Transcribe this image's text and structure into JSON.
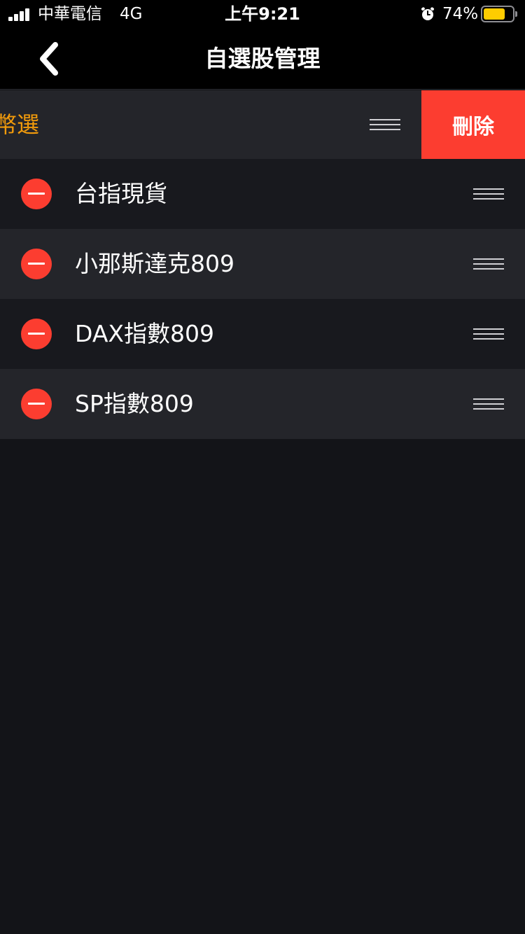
{
  "status_bar": {
    "carrier": "中華電信",
    "network": "4G",
    "time": "上午9:21",
    "battery_percent": "74%",
    "battery_level": 0.74,
    "icons": [
      "signal-icon",
      "alarm-icon",
      "battery-icon"
    ]
  },
  "nav": {
    "title": "自選股管理",
    "back_icon": "chevron-left-icon"
  },
  "swiped_row": {
    "label": "幣選",
    "delete_label": "刪除"
  },
  "rows": [
    {
      "label": "台指現貨"
    },
    {
      "label": "小那斯達克809"
    },
    {
      "label": "DAX指數809"
    },
    {
      "label": "SP指數809"
    }
  ],
  "colors": {
    "accent_orange": "#f29b0b",
    "delete_red": "#fc3d30",
    "battery_yellow": "#ffcc00",
    "background": "#131418"
  }
}
